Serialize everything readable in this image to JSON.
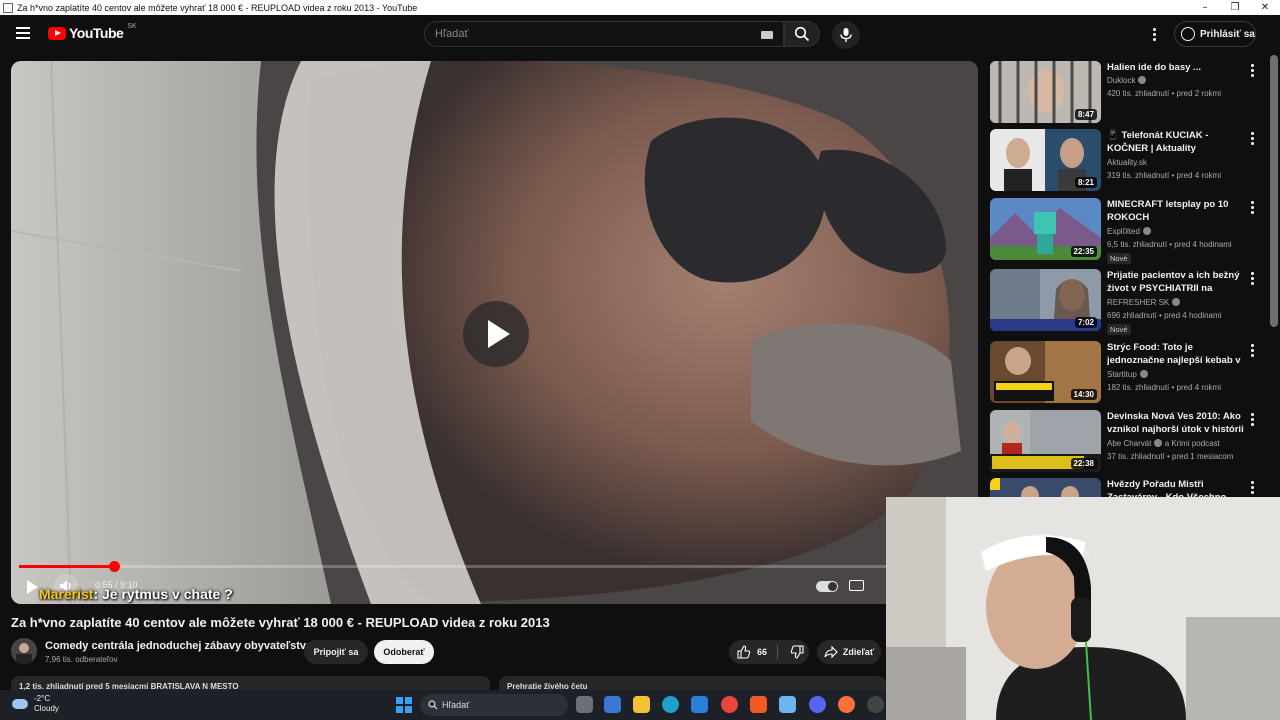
{
  "window": {
    "title": "Za h*vno zaplatíte 40 centov ale môžete vyhrať 18 000 € - REUPLOAD videa z roku 2013 - YouTube",
    "controls": [
      "–",
      "❐",
      "✕"
    ]
  },
  "header": {
    "logo_text": "YouTube",
    "country_code": "SK",
    "search_placeholder": "Hľadať",
    "signin_label": "Prihlásiť sa",
    "icons": [
      "menu-icon",
      "search-icon",
      "mic-icon",
      "more-vert-icon",
      "account-icon",
      "keyboard-icon"
    ]
  },
  "player": {
    "time": "0:55 / 9:10",
    "progress_fraction": 0.1,
    "subtitle_name": "Marerist",
    "subtitle_text": ": Je rytmus v chate ?"
  },
  "video": {
    "title": "Za h*vno zaplatíte 40 centov ale môžete vyhrať 18 000 € - REUPLOAD videa z roku 2013",
    "channel_name": "Comedy centrála jednoduchej zábavy obyvateľstva",
    "subscribers": "7,96 tis. odberateľov",
    "join_label": "Pripojiť sa",
    "subscribe_label": "Odoberať",
    "like_count": "66",
    "share_label": "Zdieľať",
    "desc_left": "1,2 tis. zhliadnutí  pred 5 mesiacmi  BRATISLAVA N MESTO",
    "desc_right": "Prehratie živého četu"
  },
  "sidebar": {
    "items": [
      {
        "title": "Halien ide do basy ...",
        "channel": "Duklock",
        "verified": true,
        "meta": "420 tis. zhliadnutí • pred 2 rokmi",
        "duration": "8:47",
        "badge": ""
      },
      {
        "title": "📱 Telefonát  KUCIAK - KOČNER | Aktuality",
        "channel": "Aktuality.sk",
        "verified": false,
        "meta": "319 tis. zhliadnutí • pred 4 rokmi",
        "duration": "8:21",
        "badge": ""
      },
      {
        "title": "MINECRAFT letsplay po 10 ROKOCH",
        "channel": "Expl0ited",
        "verified": true,
        "meta": "6,5 tis. zhliadnutí • pred 4 hodinami",
        "duration": "22:35",
        "badge": "Nové"
      },
      {
        "title": "Prijatie pacientov a ich bežný život v PSYCHIATRII na Predn...",
        "channel": "REFRESHER SK",
        "verified": true,
        "meta": "696 zhliadnutí • pred 4 hodinami",
        "duration": "7:02",
        "badge": "Nové"
      },
      {
        "title": "Strýc Food: Toto je jednoznačne najlepší kebab v Bratislave 🤞",
        "channel": "Startitup",
        "verified": true,
        "meta": "182 tis. zhliadnutí • pred 4 rokmi",
        "duration": "14:30",
        "badge": ""
      },
      {
        "title": "Devinska Nová Ves 2010: Ako vznikol najhorší útok v histórii ...",
        "channel": "Abe Charvát",
        "verified": true,
        "channel_extra": "a Krimi podcast",
        "meta": "37 tis. zhliadnutí • pred 1 mesiacom",
        "duration": "22:38",
        "badge": ""
      },
      {
        "title": "Hvězdy Pořadu Mistři Zastavárny - Kdo Všechno ...",
        "channel": "",
        "verified": false,
        "meta": "",
        "duration": "",
        "badge": ""
      }
    ]
  },
  "taskbar": {
    "temperature": "-2°C",
    "weather": "Cloudy",
    "search_label": "Hľadať"
  },
  "colors": {
    "background": "#0f0f0f",
    "accent_red": "#ff0000",
    "subtitle_name": "#f5c518"
  }
}
